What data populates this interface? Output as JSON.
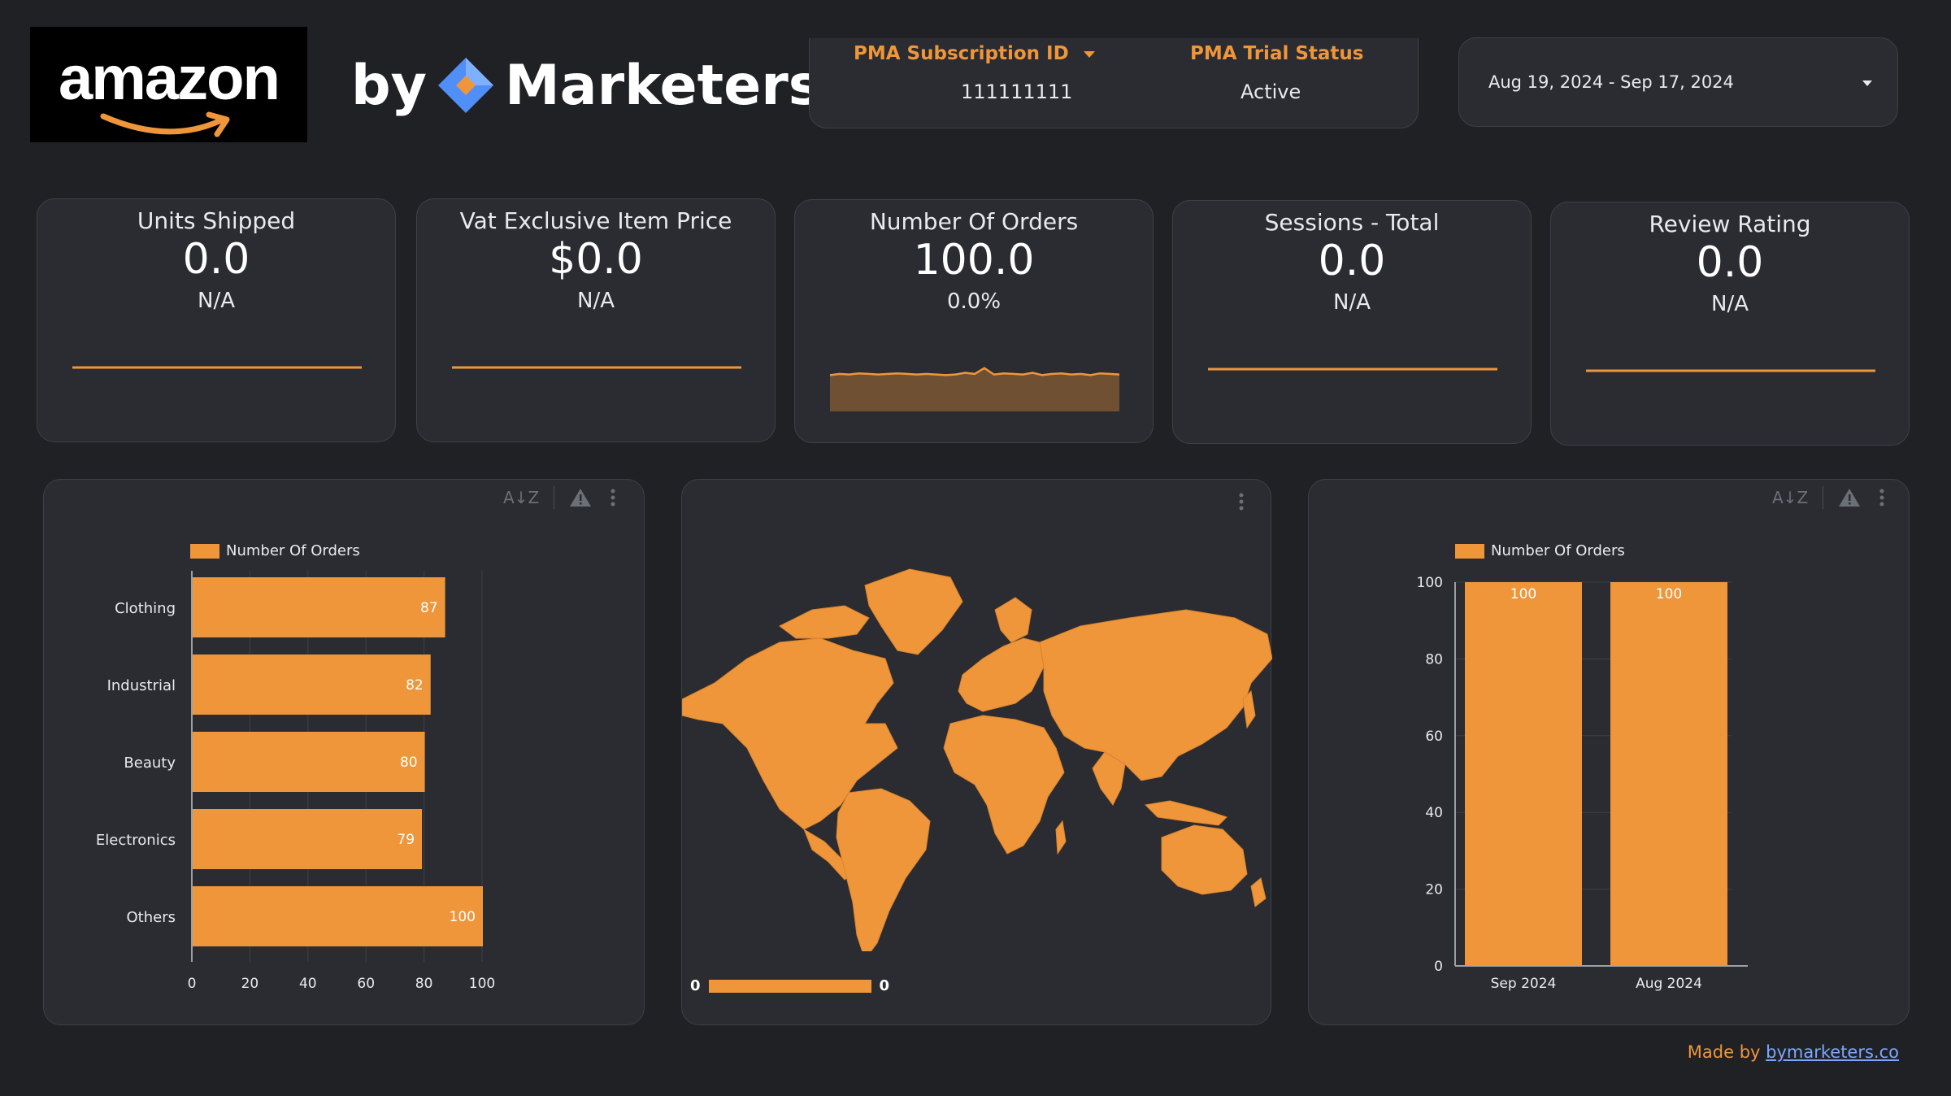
{
  "header": {
    "amazon_logo_text": "amazon",
    "brand_by": "by",
    "brand_name": "Marketers",
    "subscription_label": "PMA Subscription ID",
    "subscription_value": "111111111",
    "trial_label": "PMA Trial Status",
    "trial_value": "Active",
    "date_range": "Aug 19, 2024 - Sep 17, 2024"
  },
  "kpis": [
    {
      "title": "Units Shipped",
      "value": "0.0",
      "change": "N/A"
    },
    {
      "title": "Vat Exclusive Item Price",
      "value": "$0.0",
      "change": "N/A"
    },
    {
      "title": "Number Of Orders",
      "value": "100.0",
      "change": "0.0%"
    },
    {
      "title": "Sessions - Total",
      "value": "0.0",
      "change": "N/A"
    },
    {
      "title": "Review Rating",
      "value": "0.0",
      "change": "N/A"
    }
  ],
  "colors": {
    "accent": "#f0963a",
    "background": "#202124",
    "card": "#2a2c31",
    "link": "#7aa7ff"
  },
  "icons": [
    "sort-az-icon",
    "warning-icon",
    "more-vert-icon",
    "dropdown-arrow-icon",
    "marketers-diamond-icon",
    "amazon-smile-icon"
  ],
  "chart_data": [
    {
      "type": "bar",
      "orientation": "horizontal",
      "legend": "Number Of Orders",
      "series": [
        {
          "name": "Number Of Orders",
          "values": [
            87,
            82,
            80,
            79,
            100
          ]
        }
      ],
      "categories": [
        "Clothing",
        "Industrial",
        "Beauty",
        "Electronics",
        "Others"
      ],
      "values": [
        87,
        82,
        80,
        79,
        100
      ],
      "xlim": [
        0,
        100
      ],
      "x_ticks": [
        "0",
        "20",
        "40",
        "60",
        "80",
        "100"
      ]
    },
    {
      "type": "map",
      "scale_min_label": "0",
      "scale_max_label": "0"
    },
    {
      "type": "bar",
      "legend": "Number Of Orders",
      "series": [
        {
          "name": "Number Of Orders",
          "values": [
            100,
            100
          ]
        }
      ],
      "categories": [
        "Sep 2024",
        "Aug 2024"
      ],
      "values": [
        100,
        100
      ],
      "ylim": [
        0,
        100
      ],
      "y_ticks": [
        "0",
        "20",
        "40",
        "60",
        "80",
        "100"
      ]
    }
  ],
  "orders_spark": [
    62,
    64,
    63,
    65,
    64,
    63,
    64,
    65,
    64,
    63,
    64,
    63,
    62,
    63,
    66,
    64,
    74,
    63,
    65,
    64,
    63,
    66,
    62,
    64,
    65,
    63,
    64,
    62,
    65,
    64,
    63
  ],
  "footer": {
    "made_by": "Made by",
    "link_text": "bymarketers.co"
  }
}
